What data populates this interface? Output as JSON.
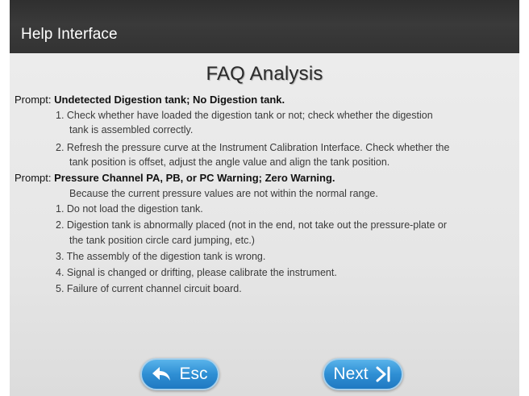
{
  "header": {
    "title": "Help Interface"
  },
  "page": {
    "heading": "FAQ Analysis"
  },
  "prompt1": {
    "prefix": "Prompt: ",
    "title": "Undetected Digestion tank; No Digestion tank.",
    "lines": [
      "1. Check whether have loaded the digestion tank or not; check whether the digestion",
      "tank is assembled correctly.",
      "2. Refresh the pressure curve at the Instrument Calibration Interface. Check whether the",
      "tank position is offset, adjust the angle value and align the tank position."
    ]
  },
  "prompt2": {
    "prefix": "Prompt: ",
    "title": "Pressure Channel PA, PB, or PC Warning; Zero Warning.",
    "lines": [
      "Because the current pressure values are not within the normal range.",
      "1. Do not load the digestion tank.",
      "2. Digestion tank is abnormally placed (not in the end, not take out the pressure-plate or",
      "the tank position circle card jumping, etc.)",
      "3. The assembly of the digestion tank is wrong.",
      "4. Signal is changed or drifting, please calibrate the instrument.",
      "5. Failure of current channel circuit board."
    ]
  },
  "buttons": {
    "esc_label": "Esc",
    "next_label": "Next",
    "esc_icon": "back-arrow-icon",
    "next_icon": "skip-next-icon"
  },
  "colors": {
    "button": "#2f8fd4",
    "titlebar": "#333333"
  }
}
